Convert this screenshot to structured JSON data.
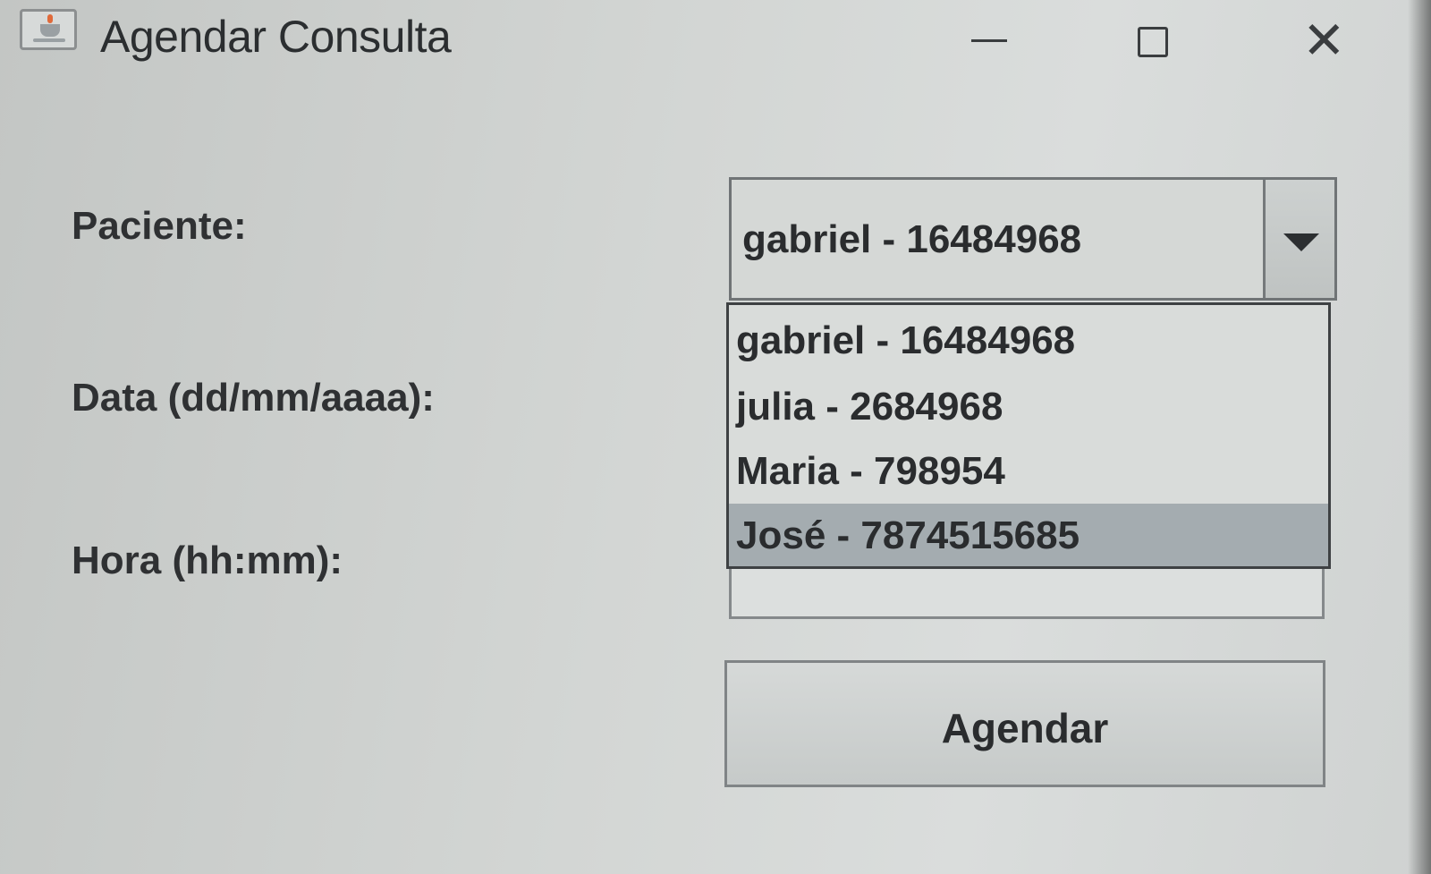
{
  "window": {
    "title": "Agendar Consulta"
  },
  "form": {
    "paciente_label": "Paciente:",
    "data_label": "Data (dd/mm/aaaa):",
    "hora_label": "Hora (hh:mm):",
    "paciente_selected": "gabriel - 16484968",
    "hora_value": "",
    "submit_label": "Agendar"
  },
  "dropdown": {
    "options": [
      "gabriel - 16484968",
      "julia - 2684968",
      "Maria - 798954",
      "José - 7874515685"
    ],
    "highlighted_index": 3
  },
  "colors": {
    "highlight": "#a4acb0",
    "window_bg": "#d3d6d4"
  },
  "icons": {
    "app": "java-app-icon",
    "minimize": "minimize-icon",
    "maximize": "maximize-icon",
    "close": "close-icon",
    "dropdown": "chevron-down-icon"
  }
}
